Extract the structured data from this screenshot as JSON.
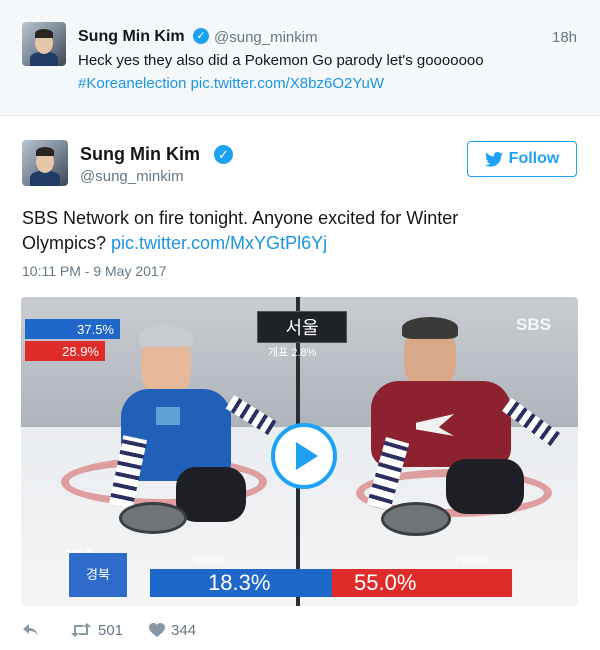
{
  "reply_tweet": {
    "name": "Sung Min Kim",
    "handle": "@sung_minkim",
    "time": "18h",
    "text_line1": "Heck yes they also did a Pokemon Go parody let's gooooooo",
    "hashtag": "#Koreanelection",
    "link": "pic.twitter.com/X8bz6O2YuW"
  },
  "main_tweet": {
    "name": "Sung Min Kim",
    "handle": "@sung_minkim",
    "follow_label": "Follow",
    "text_line1": "SBS Network on fire tonight. Anyone excited for Winter",
    "text_line2_prefix": "Olympics?",
    "link": "pic.twitter.com/MxYGtPl6Yj",
    "timestamp": "10:11 PM - 9 May 2017"
  },
  "media": {
    "network_logo": "SBS",
    "city_label": "서울",
    "count_label": "개표 2.8%",
    "top_left_scores": [
      "37.5%",
      "28.9%"
    ],
    "bottom_region": "경북",
    "bottom_year": "2017",
    "left_votes": "43,601",
    "right_votes": "138,761",
    "left_pct": "18.3%",
    "right_pct": "55.0%"
  },
  "actions": {
    "retweets": "501",
    "likes": "344"
  },
  "colors": {
    "link": "#1b95e0",
    "accent": "#1da1f2",
    "muted": "#657786"
  }
}
